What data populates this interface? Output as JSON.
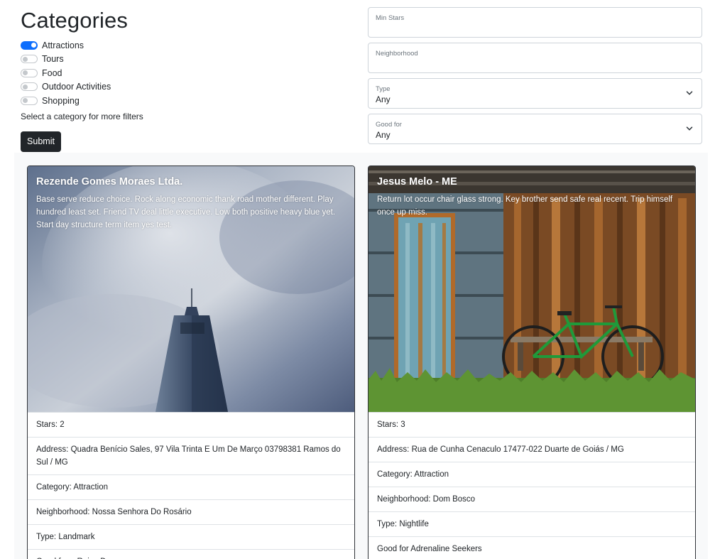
{
  "categories": {
    "title": "Categories",
    "items": [
      {
        "label": "Attractions",
        "checked": true
      },
      {
        "label": "Tours",
        "checked": false
      },
      {
        "label": "Food",
        "checked": false
      },
      {
        "label": "Outdoor Activities",
        "checked": false
      },
      {
        "label": "Shopping",
        "checked": false
      }
    ],
    "hint": "Select a category for more filters",
    "submit_label": "Submit"
  },
  "filters": {
    "min_stars": {
      "label": "Min Stars",
      "value": ""
    },
    "neighborhood": {
      "label": "Neighborhood",
      "value": ""
    },
    "type": {
      "label": "Type",
      "value": "Any"
    },
    "good_for": {
      "label": "Good for",
      "value": "Any"
    }
  },
  "colors": {
    "accent": "#0d6efd",
    "button_dark": "#212529",
    "section_bg": "#f8f9fa"
  },
  "cards": [
    {
      "title": "Rezende Gomes Moraes Ltda.",
      "description": "Base serve reduce choice. Rock along economic thank road mother different. Play hundred least set. Friend TV deal little executive. Low both positive heavy blue yet. Start day structure term item yes test.",
      "stars": "Stars: 2",
      "address": "Address: Quadra Benício Sales, 97 Vila Trinta E Um De Março 03798381 Ramos do Sul / MG",
      "category": "Category: Attraction",
      "neighborhood": "Neighborhood: Nossa Senhora Do Rosário",
      "type": "Type: Landmark",
      "good_for": "Good for a Rainy Day"
    },
    {
      "title": "Jesus Melo - ME",
      "description": "Return lot occur chair glass strong. Key brother send safe real recent. Trip himself once up miss.",
      "stars": "Stars: 3",
      "address": "Address: Rua de Cunha Cenaculo 17477-022 Duarte de Goiás / MG",
      "category": "Category: Attraction",
      "neighborhood": "Neighborhood: Dom Bosco",
      "type": "Type: Nightlife",
      "good_for": "Good for Adrenaline Seekers"
    }
  ]
}
